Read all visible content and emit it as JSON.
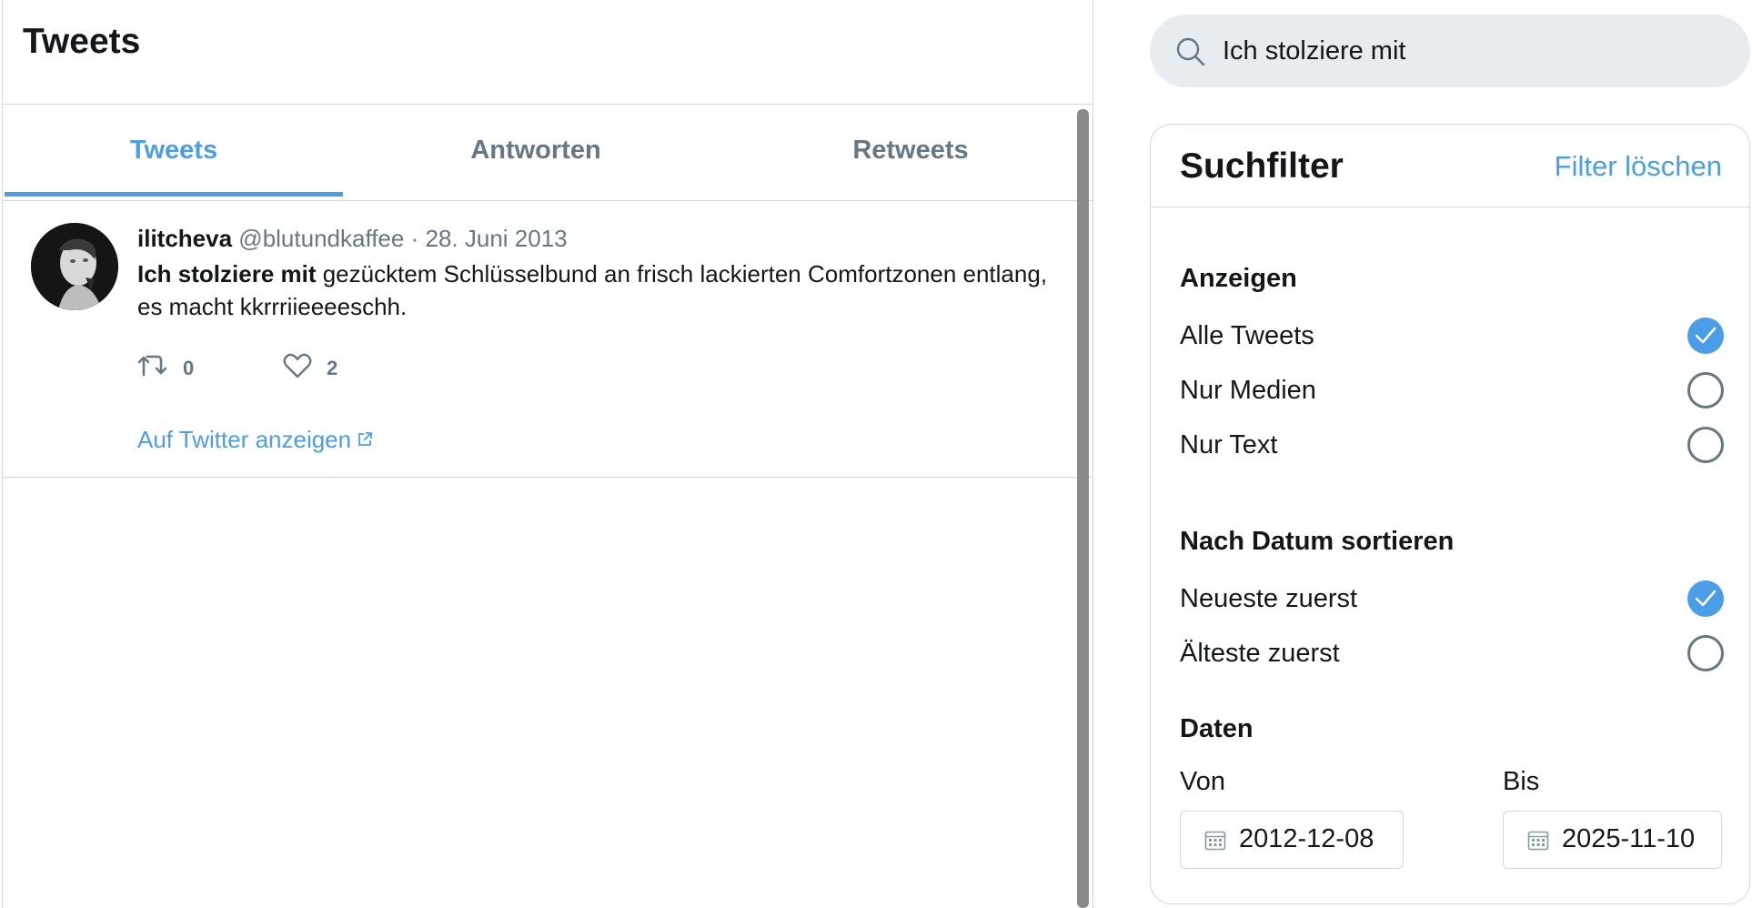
{
  "timeline": {
    "title": "Tweets",
    "tabs": [
      {
        "label": "Tweets",
        "active": true
      },
      {
        "label": "Antworten",
        "active": false
      },
      {
        "label": "Retweets",
        "active": false
      }
    ],
    "tweet": {
      "name": "ilitcheva",
      "handle": "@blutundkaffee",
      "separator": "·",
      "date": "28. Juni 2013",
      "text_highlight": "Ich stolziere mit",
      "text_rest": " gezücktem Schlüsselbund an frisch lackierten Comfortzonen entlang, es macht kkrrriieeeeschh.",
      "retweets": "0",
      "likes": "2",
      "view_link": "Auf Twitter anzeigen"
    }
  },
  "search": {
    "value": "Ich stolziere mit"
  },
  "filters": {
    "title": "Suchfilter",
    "clear_label": "Filter löschen",
    "show": {
      "title": "Anzeigen",
      "options": [
        {
          "label": "Alle Tweets",
          "checked": true
        },
        {
          "label": "Nur Medien",
          "checked": false
        },
        {
          "label": "Nur Text",
          "checked": false
        }
      ]
    },
    "sort": {
      "title": "Nach Datum sortieren",
      "options": [
        {
          "label": "Neueste zuerst",
          "checked": true
        },
        {
          "label": "Älteste zuerst",
          "checked": false
        }
      ]
    },
    "dates": {
      "title": "Daten",
      "from_label": "Von",
      "from_value": "2012-12-08",
      "to_label": "Bis",
      "to_value": "2025-11-10"
    }
  },
  "colors": {
    "accent": "#4a9ee8",
    "muted": "#657786",
    "border": "#cfd9de",
    "search_bg": "#e6ecf0"
  }
}
